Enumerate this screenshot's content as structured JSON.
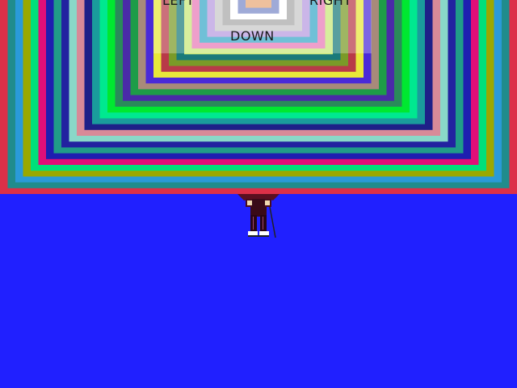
{
  "controls": {
    "left_label": "LEFT",
    "right_label": "RIGHT",
    "down_label": "DOWN"
  },
  "scene": {
    "ground_color": "#2020ff",
    "tunnel_colors": [
      "#dc3048",
      "#208c8c",
      "#2a9ad8",
      "#9aa800",
      "#00e07a",
      "#e00f78",
      "#1e1eb0",
      "#209c88",
      "#2222a0",
      "#8ad8c8",
      "#d88a98",
      "#1e2088",
      "#1a9c9c",
      "#00e890",
      "#00e830",
      "#2a8a5a",
      "#4a2aa8",
      "#1e9c48",
      "#a88a7a",
      "#4a2ad8",
      "#e8e83a",
      "#b83a48",
      "#7a9a28",
      "#1a7a7a",
      "#c8e878",
      "#e87ab8",
      "#3aa8c8",
      "#b89ae0",
      "#c8c8c8",
      "#a8a8a8",
      "#ffffff",
      "#7a8ac8",
      "#e8a878"
    ]
  },
  "player": {
    "sprite": "character-with-staff"
  }
}
